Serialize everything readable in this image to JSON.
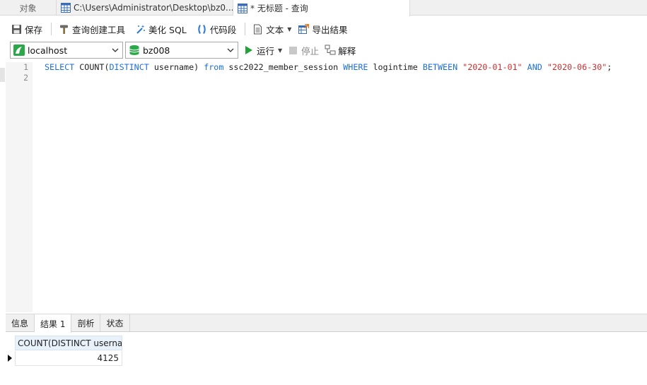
{
  "tabs": {
    "objects": "对象",
    "file": "C:\\Users\\Administrator\\Desktop\\bz0...",
    "query": "* 无标题 - 查询"
  },
  "toolbar1": {
    "save": "保存",
    "query_builder": "查询创建工具",
    "beautify_sql": "美化 SQL",
    "code_snippet": "代码段",
    "text": "文本",
    "export_results": "导出结果"
  },
  "toolbar2": {
    "connection": "localhost",
    "database": "bz008",
    "run": "运行",
    "stop": "停止",
    "explain": "解释"
  },
  "editor": {
    "line_numbers": [
      "1",
      "2"
    ],
    "tokens": {
      "select": "SELECT",
      "count_call": " COUNT(",
      "distinct": "DISTINCT",
      "username": " username) ",
      "from": "from",
      "table": " ssc2022_member_session ",
      "where": "WHERE",
      "column": " logintime ",
      "between": "BETWEEN",
      "sp1": " ",
      "date1": "\"2020-01-01\"",
      "sp2": " ",
      "and": "AND",
      "sp3": " ",
      "date2": "\"2020-06-30\"",
      "semicolon": ";"
    }
  },
  "result_tabs": [
    "信息",
    "结果 1",
    "剖析",
    "状态"
  ],
  "result": {
    "column": "COUNT(DISTINCT userna",
    "value": "4125"
  },
  "colors": {
    "keyword": "#1b6fd8",
    "string": "#d22b2b",
    "run_green": "#22a33a"
  }
}
